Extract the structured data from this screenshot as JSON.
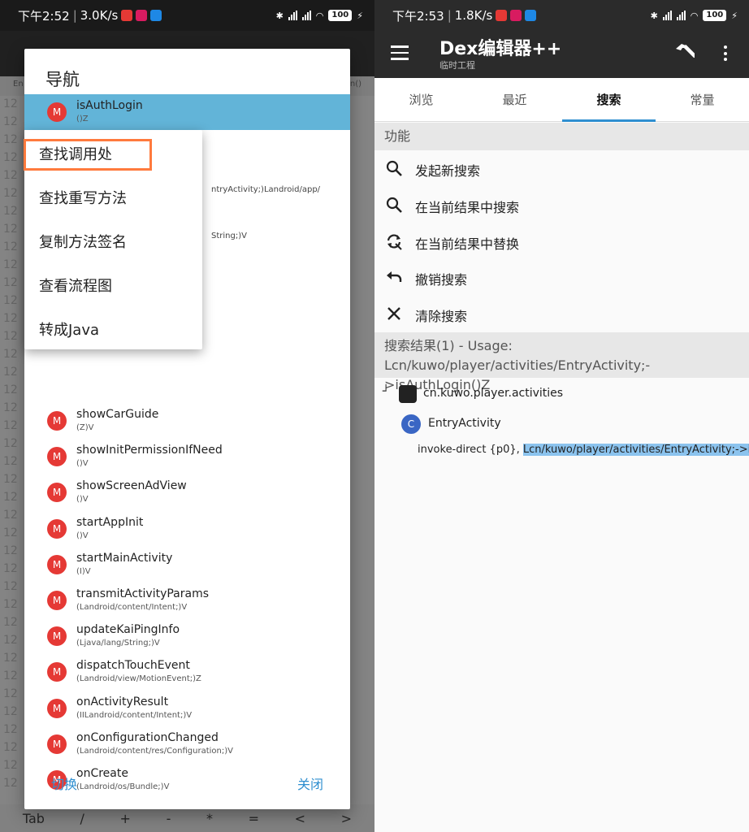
{
  "left_status": {
    "time": "下午2:52",
    "speed": "3.0K/s",
    "battery": "100"
  },
  "right_status": {
    "time": "下午2:53",
    "speed": "1.8K/s",
    "battery": "100"
  },
  "editor": {
    "tab_left": "En",
    "tab_right": "n()",
    "keys": [
      "Tab",
      "/",
      "+",
      "-",
      "*",
      "=",
      "<",
      ">"
    ]
  },
  "nav_dialog": {
    "title": "导航",
    "selected": {
      "badge": "M",
      "name": "isAuthLogin",
      "sig": "()Z"
    },
    "methods": [
      {
        "badge": "M",
        "name": "showCarGuide",
        "sig": "(Z)V"
      },
      {
        "badge": "M",
        "name": "showInitPermissionIfNeed",
        "sig": "()V"
      },
      {
        "badge": "M",
        "name": "showScreenAdView",
        "sig": "()V"
      },
      {
        "badge": "M",
        "name": "startAppInit",
        "sig": "()V"
      },
      {
        "badge": "M",
        "name": "startMainActivity",
        "sig": "(I)V"
      },
      {
        "badge": "M",
        "name": "transmitActivityParams",
        "sig": "(Landroid/content/Intent;)V"
      },
      {
        "badge": "M",
        "name": "updateKaiPingInfo",
        "sig": "(Ljava/lang/String;)V"
      },
      {
        "badge": "M",
        "name": "dispatchTouchEvent",
        "sig": "(Landroid/view/MotionEvent;)Z"
      },
      {
        "badge": "M",
        "name": "onActivityResult",
        "sig": "(IILandroid/content/Intent;)V"
      },
      {
        "badge": "M",
        "name": "onConfigurationChanged",
        "sig": "(Landroid/content/res/Configuration;)V"
      },
      {
        "badge": "M",
        "name": "onCreate",
        "sig": "(Landroid/os/Bundle;)V"
      }
    ],
    "peek_1": "ntryActivity;)Landroid/app/",
    "peek_2": "String;)V",
    "switch_label": "切换",
    "close_label": "关闭"
  },
  "context_menu": {
    "items": [
      "查找调用处",
      "查找重写方法",
      "复制方法签名",
      "查看流程图",
      "转成Java"
    ]
  },
  "app": {
    "title": "Dex编辑器++",
    "subtitle": "临时工程"
  },
  "tabs": [
    "浏览",
    "最近",
    "搜索",
    "常量"
  ],
  "functions": {
    "header": "功能",
    "items": [
      {
        "icon": "search-icon",
        "label": "发起新搜索"
      },
      {
        "icon": "search-icon",
        "label": "在当前结果中搜索"
      },
      {
        "icon": "replace-icon",
        "label": "在当前结果中替换"
      },
      {
        "icon": "undo-icon",
        "label": "撤销搜索"
      },
      {
        "icon": "close-icon",
        "label": "清除搜索"
      }
    ]
  },
  "results": {
    "header": "搜索结果(1) - Usage: Lcn/kuwo/player/activities/EntryActivity;->isAuthLogin()Z",
    "package": "cn.kuwo.player.activities",
    "class_badge": "C",
    "class_name": "EntryActivity",
    "code_prefix": "invoke-direct {p0}, ",
    "code_highlight": "Lcn/kuwo/player/activities/EntryActivity;->is..."
  }
}
